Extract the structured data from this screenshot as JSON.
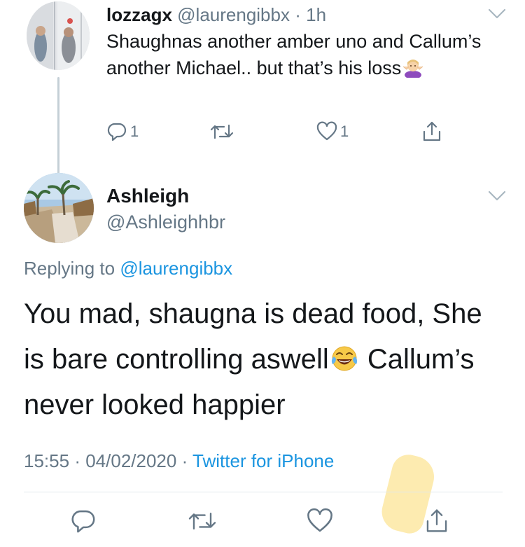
{
  "parent_tweet": {
    "name": "lozzagx",
    "handle": "@laurengibbx",
    "separator": "·",
    "time": "1h",
    "text": "Shaughnas another amber uno and Callum’s another Michael.. but that’s his loss",
    "emoji": "person-shrugging",
    "actions": {
      "reply_count": "1",
      "retweet_count": "",
      "like_count": "1"
    }
  },
  "main_tweet": {
    "name": "Ashleigh",
    "handle": "@Ashleighhbr",
    "replying_label": "Replying to",
    "replying_to": "@laurengibbx",
    "text_part1": "You mad, shaugna is dead food, She is bare controlling aswell",
    "emoji": "face-with-tears-of-joy",
    "text_part2": " Callum’s never looked happier",
    "time": "15:55",
    "separator": "·",
    "date": "04/02/2020",
    "separator2": "·",
    "source": "Twitter for iPhone"
  },
  "colors": {
    "link": "#1b95e0",
    "secondary_text": "#657786",
    "icon": "#657786",
    "divider": "#e1e8ed"
  },
  "icons": [
    "chevron-down-icon",
    "reply-icon",
    "retweet-icon",
    "like-icon",
    "share-icon"
  ]
}
